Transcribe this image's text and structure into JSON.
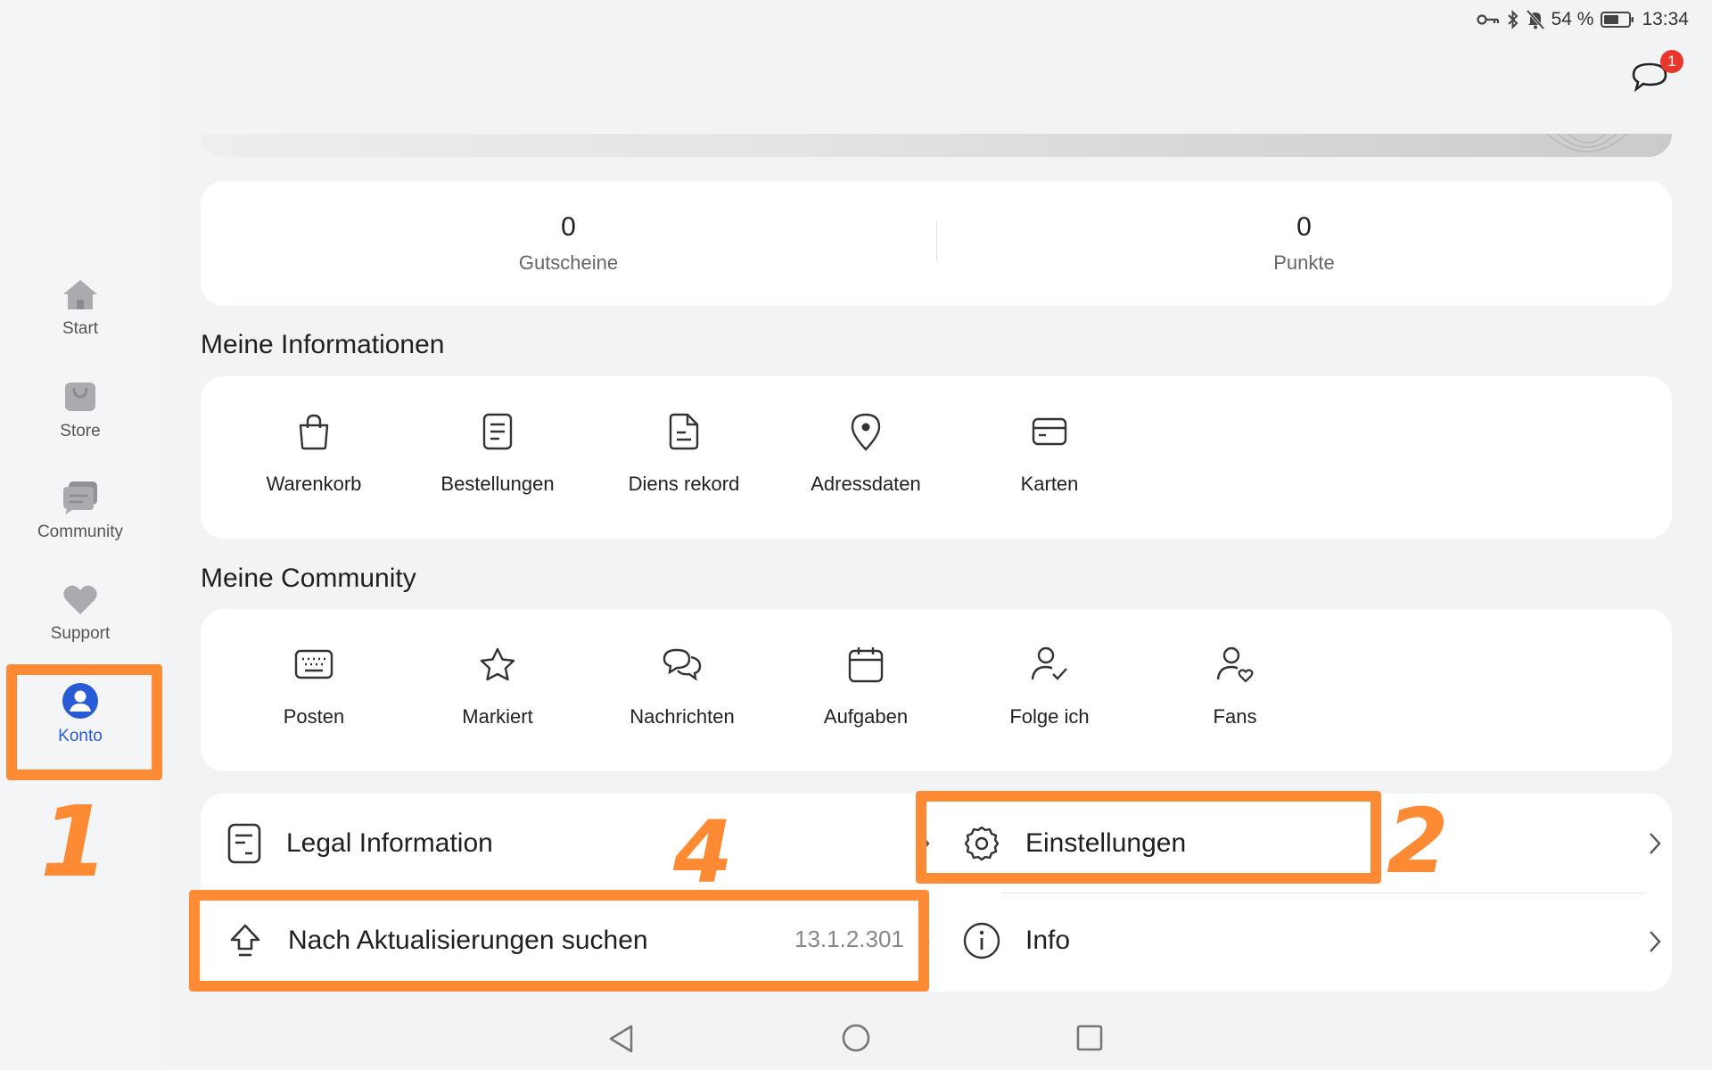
{
  "status_bar": {
    "battery": "54 %",
    "time": "13:34"
  },
  "header": {
    "messages_badge": "1"
  },
  "sidebar": {
    "items": [
      {
        "label": "Start"
      },
      {
        "label": "Store"
      },
      {
        "label": "Community"
      },
      {
        "label": "Support"
      },
      {
        "label": "Konto"
      }
    ]
  },
  "stats": [
    {
      "value": "0",
      "label": "Gutscheine"
    },
    {
      "value": "0",
      "label": "Punkte"
    }
  ],
  "my_info": {
    "title": "Meine Informationen",
    "items": [
      {
        "label": "Warenkorb"
      },
      {
        "label": "Bestellungen"
      },
      {
        "label": "Diens rekord"
      },
      {
        "label": "Adressdaten"
      },
      {
        "label": "Karten"
      }
    ]
  },
  "my_community": {
    "title": "Meine Community",
    "items": [
      {
        "label": "Posten"
      },
      {
        "label": "Markiert"
      },
      {
        "label": "Nachrichten"
      },
      {
        "label": "Aufgaben"
      },
      {
        "label": "Folge ich"
      },
      {
        "label": "Fans"
      }
    ]
  },
  "settings_list": {
    "legal": "Legal Information",
    "settings": "Einstellungen",
    "update": "Nach Aktualisierungen suchen",
    "version": "13.1.2.301",
    "info": "Info"
  },
  "annotations": {
    "one": "1",
    "two": "2",
    "four": "4"
  },
  "colors": {
    "accent": "#2a5bd7",
    "highlight": "#ff8a34",
    "badge": "#e8372c"
  }
}
